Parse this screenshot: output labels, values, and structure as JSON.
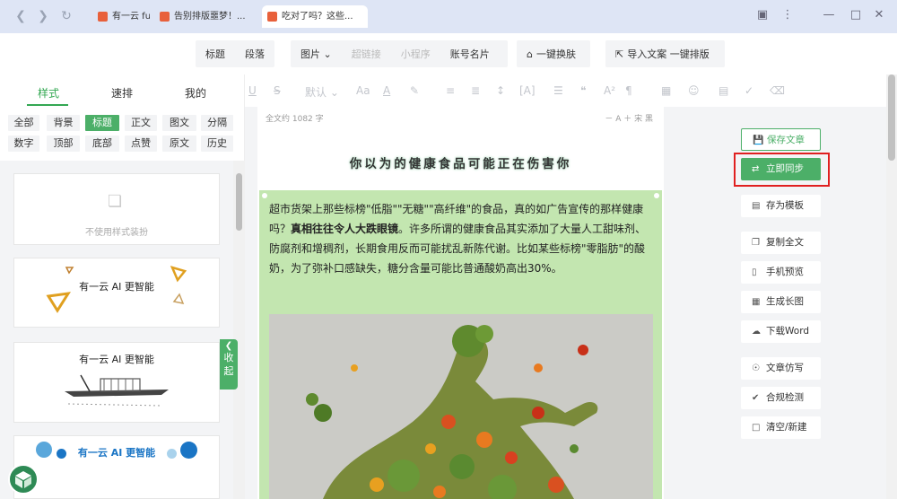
{
  "browser": {
    "tabs": [
      {
        "label": "有一云 fu"
      },
      {
        "label": "告别排版噩梦！..."
      },
      {
        "label": "吃对了吗？这些..."
      }
    ]
  },
  "top_toolbar": {
    "group1": [
      "标题",
      "段落"
    ],
    "group2": [
      "图片 ⌄",
      "超链接",
      "小程序",
      "账号名片"
    ],
    "skin_btn": "一键换肤",
    "import_btn": "导入文案 一键排版"
  },
  "left_panel": {
    "tabs": [
      "样式",
      "速排",
      "我的"
    ],
    "chips_row1": [
      "全部",
      "背景",
      "标题",
      "正文",
      "图文",
      "分隔"
    ],
    "chips_row2": [
      "数字",
      "顶部",
      "底部",
      "点赞",
      "原文",
      "历史"
    ],
    "active_chip": "标题",
    "no_style_label": "不使用样式装扮",
    "template_text": "有一云 AI 更智能",
    "collapse_label": "收起"
  },
  "editor_toolbar": {
    "font_size_label": "默认"
  },
  "document": {
    "word_count": "全文约 1082 字",
    "font_controls": "－ A ＋ 宋 黑",
    "title": "你以为的健康食品可能正在伤害你",
    "paragraph_pre": "超市货架上那些标榜\"低脂\"\"无糖\"\"高纤维\"的食品，真的如广告宣传的那样健康吗？",
    "paragraph_bold": "真相往往令人大跌眼镜",
    "paragraph_post": "。许多所谓的健康食品其实添加了大量人工甜味剂、防腐剂和增稠剂，长期食用反而可能扰乱新陈代谢。比如某些标榜\"零脂肪\"的酸奶，为了弥补口感缺失，糖分含量可能比普通酸奶高出30%。"
  },
  "right_panel": {
    "save": "保存文章",
    "sync": "立即同步",
    "template": "存为模板",
    "copy": "复制全文",
    "preview": "手机预览",
    "long_image": "生成长图",
    "download": "下载Word",
    "rewrite": "文章仿写",
    "compliance": "合规检测",
    "clear": "清空/新建"
  }
}
